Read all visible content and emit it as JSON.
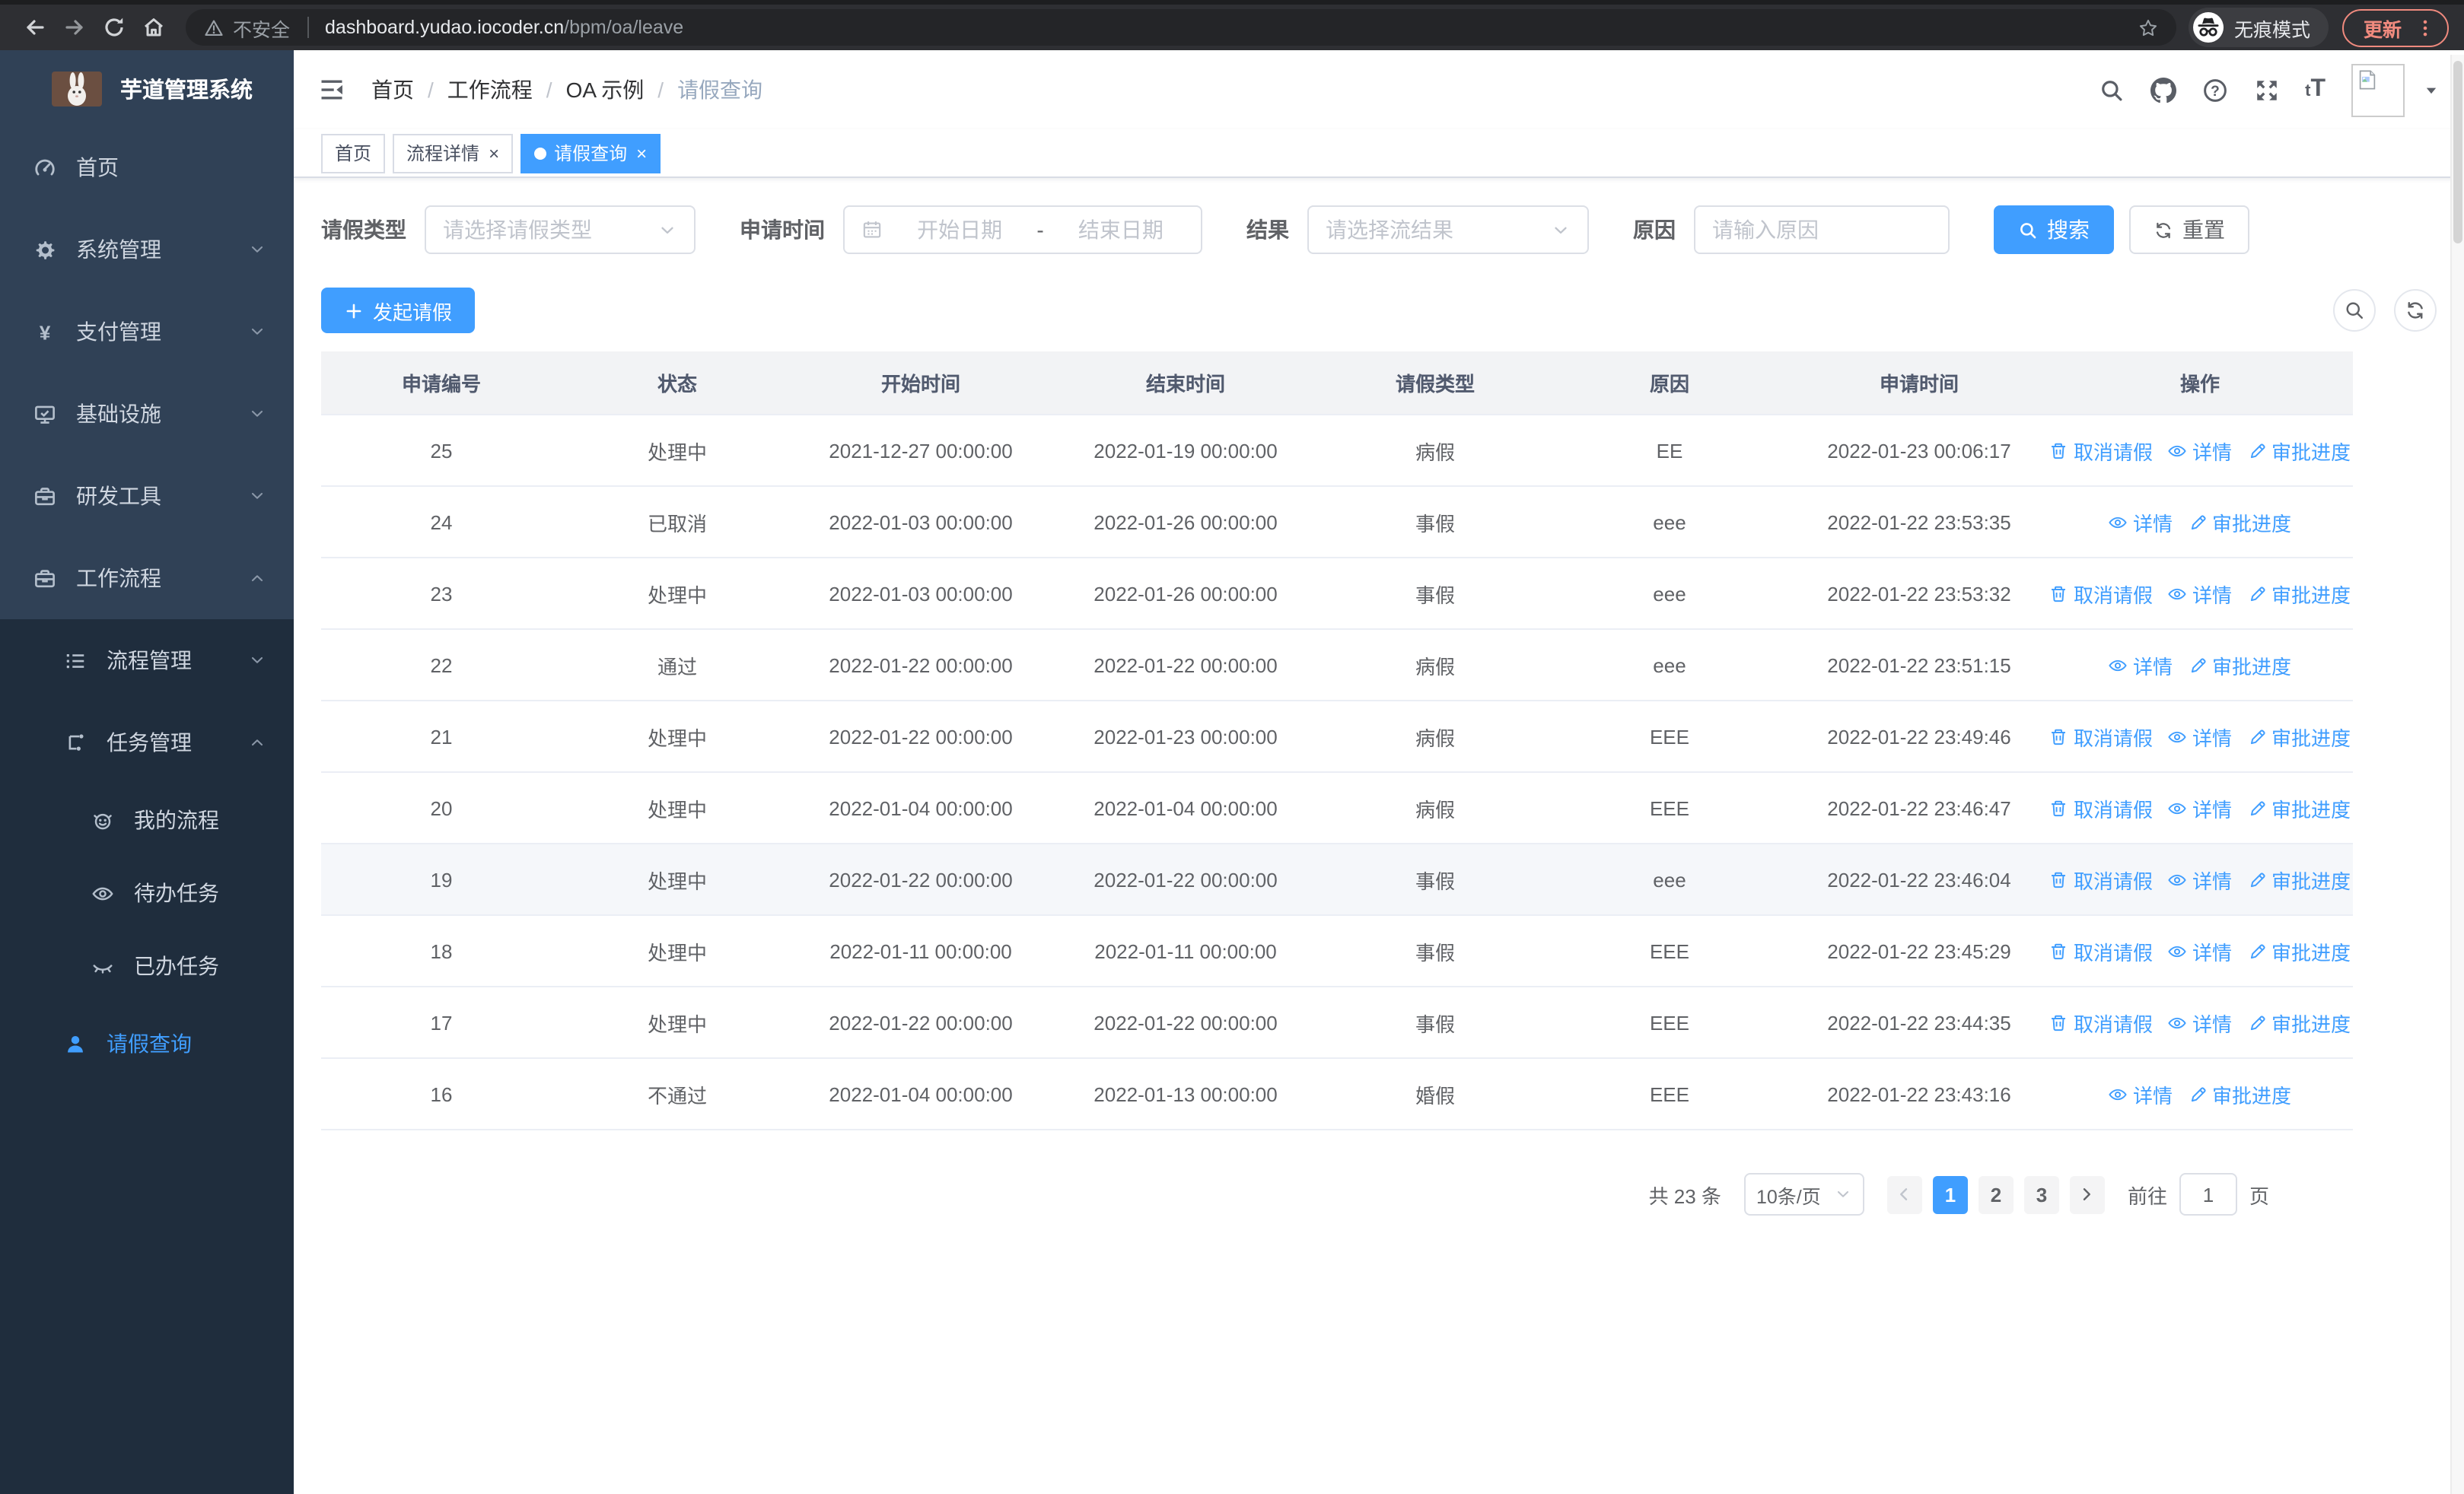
{
  "browser": {
    "security_label": "不安全",
    "url_host": "dashboard.yudao.iocoder.cn",
    "url_path": "/bpm/oa/leave",
    "incognito_label": "无痕模式",
    "update_label": "更新"
  },
  "sidebar": {
    "app_title": "芋道管理系统",
    "items": [
      {
        "key": "home",
        "label": "首页",
        "icon": "dashboard-icon",
        "chevron": null
      },
      {
        "key": "system",
        "label": "系统管理",
        "icon": "gear-icon",
        "chevron": "down"
      },
      {
        "key": "payment",
        "label": "支付管理",
        "icon": "yen-icon",
        "chevron": "down"
      },
      {
        "key": "infra",
        "label": "基础设施",
        "icon": "monitor-icon",
        "chevron": "down"
      },
      {
        "key": "devtools",
        "label": "研发工具",
        "icon": "toolbox-icon",
        "chevron": "down"
      },
      {
        "key": "workflow",
        "label": "工作流程",
        "icon": "briefcase-icon",
        "chevron": "up"
      }
    ],
    "submenu_items": [
      {
        "key": "process-mgmt",
        "label": "流程管理",
        "icon": "list-icon",
        "chevron": "down",
        "level": 1
      },
      {
        "key": "task-mgmt",
        "label": "任务管理",
        "icon": "flow-icon",
        "chevron": "up",
        "level": 1
      },
      {
        "key": "my-process",
        "label": "我的流程",
        "icon": "robot-icon",
        "chevron": null,
        "level": 2
      },
      {
        "key": "todo-tasks",
        "label": "待办任务",
        "icon": "eye-icon",
        "chevron": null,
        "level": 2
      },
      {
        "key": "done-tasks",
        "label": "已办任务",
        "icon": "eye-closed-icon",
        "chevron": null,
        "level": 2
      },
      {
        "key": "leave-query",
        "label": "请假查询",
        "icon": "user-icon",
        "chevron": null,
        "level": 1,
        "active": true
      }
    ]
  },
  "header": {
    "breadcrumb": [
      {
        "label": "首页"
      },
      {
        "label": "工作流程"
      },
      {
        "label": "OA 示例"
      },
      {
        "label": "请假查询",
        "current": true
      }
    ]
  },
  "tabs": [
    {
      "key": "home",
      "label": "首页",
      "closable": false,
      "active": false
    },
    {
      "key": "process-detail",
      "label": "流程详情",
      "closable": true,
      "active": false
    },
    {
      "key": "leave-query",
      "label": "请假查询",
      "closable": true,
      "active": true
    }
  ],
  "filters": {
    "leave_type": {
      "label": "请假类型",
      "placeholder": "请选择请假类型"
    },
    "apply_time": {
      "label": "申请时间",
      "start_placeholder": "开始日期",
      "separator": "-",
      "end_placeholder": "结束日期"
    },
    "result": {
      "label": "结果",
      "placeholder": "请选择流结果"
    },
    "reason": {
      "label": "原因",
      "placeholder": "请输入原因"
    },
    "search_label": "搜索",
    "reset_label": "重置"
  },
  "toolbar": {
    "create_label": "发起请假"
  },
  "table": {
    "columns": [
      {
        "label": "申请编号"
      },
      {
        "label": "状态"
      },
      {
        "label": "开始时间"
      },
      {
        "label": "结束时间"
      },
      {
        "label": "请假类型"
      },
      {
        "label": "原因"
      },
      {
        "label": "申请时间"
      },
      {
        "label": "操作"
      }
    ],
    "action_labels": {
      "cancel": "取消请假",
      "detail": "详情",
      "progress": "审批进度"
    },
    "rows": [
      {
        "id": "25",
        "status": "处理中",
        "start": "2021-12-27 00:00:00",
        "end": "2022-01-19 00:00:00",
        "type": "病假",
        "reason": "EE",
        "apply_time": "2022-01-23 00:06:17",
        "actions": [
          "cancel",
          "detail",
          "progress"
        ]
      },
      {
        "id": "24",
        "status": "已取消",
        "start": "2022-01-03 00:00:00",
        "end": "2022-01-26 00:00:00",
        "type": "事假",
        "reason": "eee",
        "apply_time": "2022-01-22 23:53:35",
        "actions": [
          "detail",
          "progress"
        ]
      },
      {
        "id": "23",
        "status": "处理中",
        "start": "2022-01-03 00:00:00",
        "end": "2022-01-26 00:00:00",
        "type": "事假",
        "reason": "eee",
        "apply_time": "2022-01-22 23:53:32",
        "actions": [
          "cancel",
          "detail",
          "progress"
        ]
      },
      {
        "id": "22",
        "status": "通过",
        "start": "2022-01-22 00:00:00",
        "end": "2022-01-22 00:00:00",
        "type": "病假",
        "reason": "eee",
        "apply_time": "2022-01-22 23:51:15",
        "actions": [
          "detail",
          "progress"
        ]
      },
      {
        "id": "21",
        "status": "处理中",
        "start": "2022-01-22 00:00:00",
        "end": "2022-01-23 00:00:00",
        "type": "病假",
        "reason": "EEE",
        "apply_time": "2022-01-22 23:49:46",
        "actions": [
          "cancel",
          "detail",
          "progress"
        ]
      },
      {
        "id": "20",
        "status": "处理中",
        "start": "2022-01-04 00:00:00",
        "end": "2022-01-04 00:00:00",
        "type": "病假",
        "reason": "EEE",
        "apply_time": "2022-01-22 23:46:47",
        "actions": [
          "cancel",
          "detail",
          "progress"
        ]
      },
      {
        "id": "19",
        "status": "处理中",
        "start": "2022-01-22 00:00:00",
        "end": "2022-01-22 00:00:00",
        "type": "事假",
        "reason": "eee",
        "apply_time": "2022-01-22 23:46:04",
        "actions": [
          "cancel",
          "detail",
          "progress"
        ],
        "hover": true
      },
      {
        "id": "18",
        "status": "处理中",
        "start": "2022-01-11 00:00:00",
        "end": "2022-01-11 00:00:00",
        "type": "事假",
        "reason": "EEE",
        "apply_time": "2022-01-22 23:45:29",
        "actions": [
          "cancel",
          "detail",
          "progress"
        ]
      },
      {
        "id": "17",
        "status": "处理中",
        "start": "2022-01-22 00:00:00",
        "end": "2022-01-22 00:00:00",
        "type": "事假",
        "reason": "EEE",
        "apply_time": "2022-01-22 23:44:35",
        "actions": [
          "cancel",
          "detail",
          "progress"
        ]
      },
      {
        "id": "16",
        "status": "不通过",
        "start": "2022-01-04 00:00:00",
        "end": "2022-01-13 00:00:00",
        "type": "婚假",
        "reason": "EEE",
        "apply_time": "2022-01-22 23:43:16",
        "actions": [
          "detail",
          "progress"
        ]
      }
    ]
  },
  "pagination": {
    "total_label": "共 23 条",
    "page_size_label": "10条/页",
    "pages": [
      {
        "label": "1",
        "active": true
      },
      {
        "label": "2"
      },
      {
        "label": "3"
      }
    ],
    "goto_label": "前往",
    "goto_value": "1",
    "page_unit": "页"
  },
  "colors": {
    "accent": "#409eff",
    "link": "#409eff",
    "sidebar_bg": "#304156",
    "sidebar_sub_bg": "#1f2d3d",
    "sidebar_text": "#cfd6e0",
    "chrome_bg": "#2e2f33",
    "update_accent": "#f08a7e",
    "table_header_bg": "#f2f3f5",
    "table_border": "#ebeef5",
    "placeholder": "#c0c4cc"
  }
}
